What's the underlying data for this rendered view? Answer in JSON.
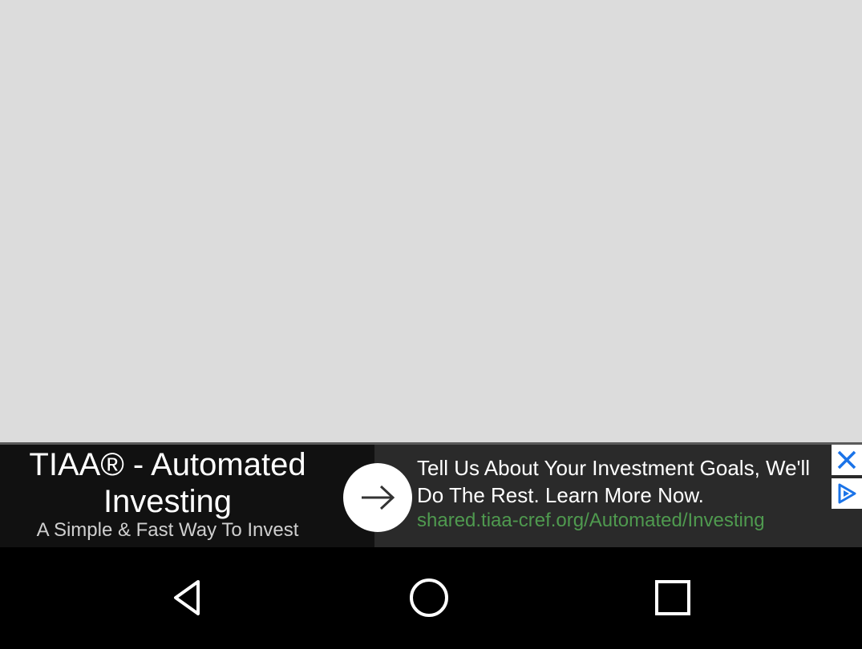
{
  "ad": {
    "title": "TIAA® - Automated Investing",
    "subtitle": "A Simple & Fast Way To Invest",
    "body": "Tell Us About Your Investment Goals, We'll Do The Rest. Learn More Now.",
    "url": "shared.tiaa-cref.org/Automated/Investing",
    "icons": {
      "arrow": "arrow-right-icon",
      "close": "close-icon",
      "choices": "ad-choices-icon"
    },
    "colors": {
      "url": "#4f9a4f",
      "choices": "#1a73e8"
    }
  },
  "nav": {
    "back": "back-icon",
    "home": "home-icon",
    "recents": "recents-icon"
  }
}
